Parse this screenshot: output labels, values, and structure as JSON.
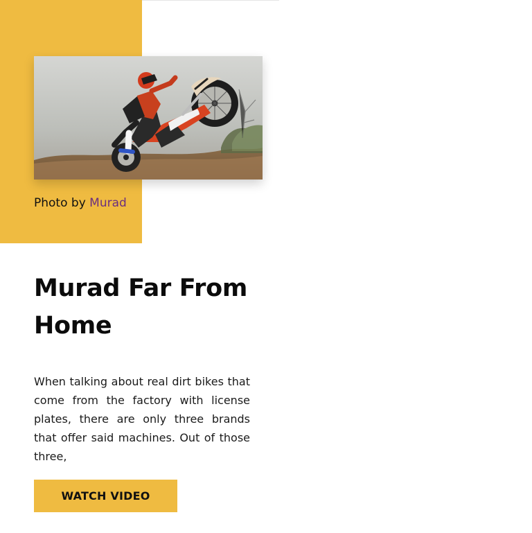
{
  "hero": {
    "image_alt": "Dirt bike rider jumping",
    "caption_prefix": "Photo by",
    "caption_author": "Murad"
  },
  "article": {
    "title": "Murad Far From Home",
    "excerpt": "When talking about real dirt bikes that come from the factory with license plates, there are only three brands that offer said machines. Out of those three,",
    "cta_label": "WATCH VIDEO"
  },
  "colors": {
    "accent_yellow": "#efbb41",
    "link_purple": "#6b2f7f",
    "text_dark": "#0b0b0b"
  }
}
